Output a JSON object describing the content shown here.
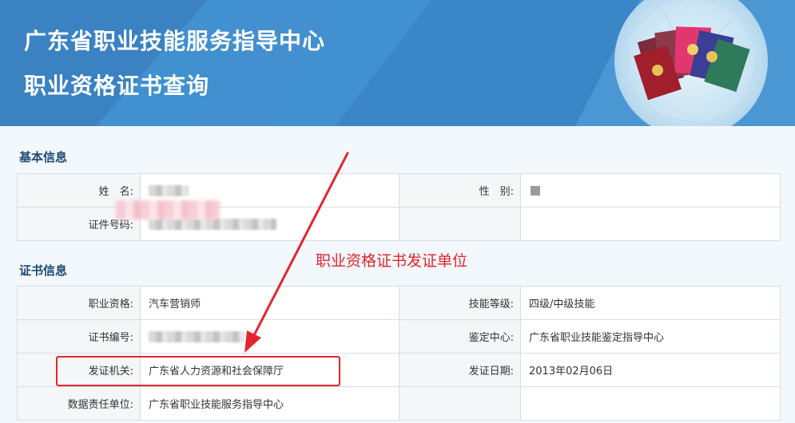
{
  "banner": {
    "title_line1": "广东省职业技能服务指导中心",
    "title_line2": "职业资格证书查询",
    "bg_color": "#3d87c8"
  },
  "basic_info": {
    "section_title": "基本信息",
    "name_label": "姓　名:",
    "gender_label": "性　别:",
    "id_label": "证件号码:"
  },
  "cert_info": {
    "section_title": "证书信息",
    "rows": [
      {
        "label1": "职业资格:",
        "value1": "汽车营销师",
        "label2": "技能等级:",
        "value2": "四级/中级技能"
      },
      {
        "label1": "证书编号:",
        "value1": "",
        "label2": "鉴定中心:",
        "value2": "广东省职业技能鉴定指导中心"
      },
      {
        "label1": "发证机关:",
        "value1": "广东省人力资源和社会保障厅",
        "label2": "发证日期:",
        "value2": "2013年02月06日"
      },
      {
        "label1": "数据责任单位:",
        "value1": "广东省职业技能服务指导中心",
        "label2": "",
        "value2": ""
      }
    ]
  },
  "annotation": {
    "text": "职业资格证书发证单位",
    "color": "#e2262e"
  }
}
